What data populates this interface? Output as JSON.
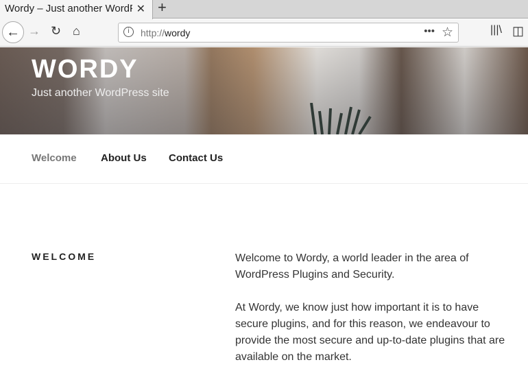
{
  "browser": {
    "tab_title": "Wordy – Just another WordPress site",
    "url_scheme": "http://",
    "url_host": "wordy"
  },
  "site": {
    "title": "WORDY",
    "tagline": "Just another WordPress site"
  },
  "menu": [
    {
      "label": "Welcome",
      "current": true
    },
    {
      "label": "About Us"
    },
    {
      "label": "Contact Us"
    }
  ],
  "page": {
    "heading": "WELCOME",
    "paragraphs": [
      "Welcome to Wordy, a world leader in the area of WordPress Plugins and Security.",
      "At Wordy, we know just how important it is to have secure plugins, and for this reason, we endeavour to provide the most secure and up-to-date plugins that are available on the market."
    ]
  }
}
